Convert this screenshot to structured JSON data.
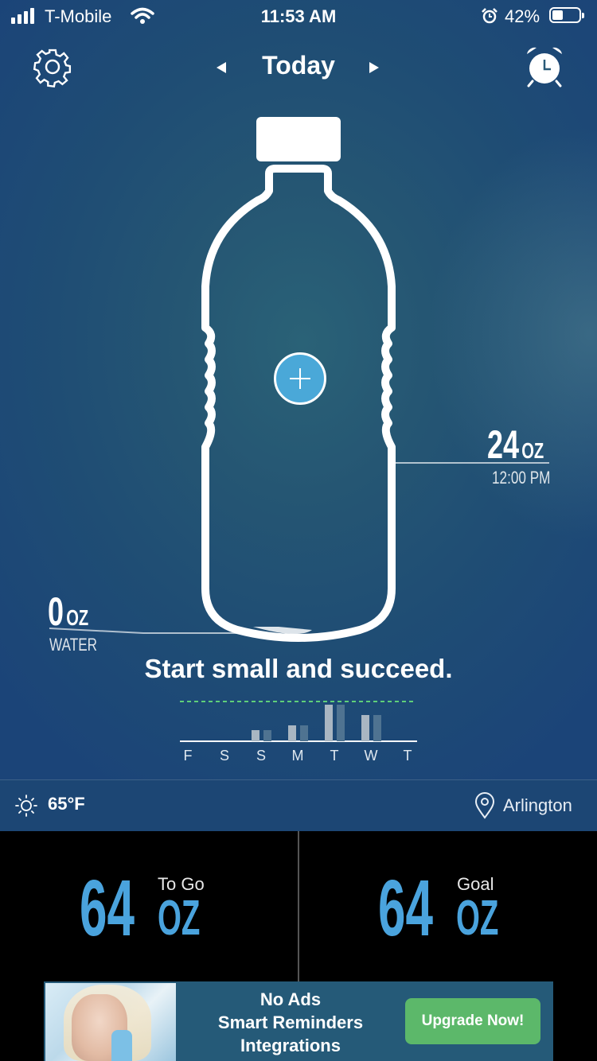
{
  "status_bar": {
    "carrier": "T-Mobile",
    "time": "11:53 AM",
    "battery_percent": "42%"
  },
  "header": {
    "title": "Today"
  },
  "bottle": {
    "right_marker": {
      "value": "24",
      "unit": "OZ",
      "time": "12:00 PM"
    },
    "left_marker": {
      "value": "0",
      "unit": "OZ",
      "label": "WATER"
    }
  },
  "tagline": "Start small and succeed.",
  "week_chart": {
    "days": [
      "F",
      "S",
      "S",
      "M",
      "T",
      "W",
      "T"
    ],
    "colors": {
      "primary": "#a9b6c2",
      "secondary": "#4f7391",
      "goal_line": "#5fcf7a"
    }
  },
  "weather": {
    "temperature": "65°F",
    "location": "Arlington"
  },
  "stats": {
    "to_go": {
      "value": "64",
      "unit": "OZ",
      "label": "To Go"
    },
    "goal": {
      "value": "64",
      "unit": "OZ",
      "label": "Goal"
    }
  },
  "ad": {
    "lines": [
      "No Ads",
      "Smart Reminders",
      "Integrations"
    ],
    "button": "Upgrade Now!"
  },
  "colors": {
    "accent_blue": "#4aa3dd",
    "upgrade_green": "#5cb86a"
  }
}
